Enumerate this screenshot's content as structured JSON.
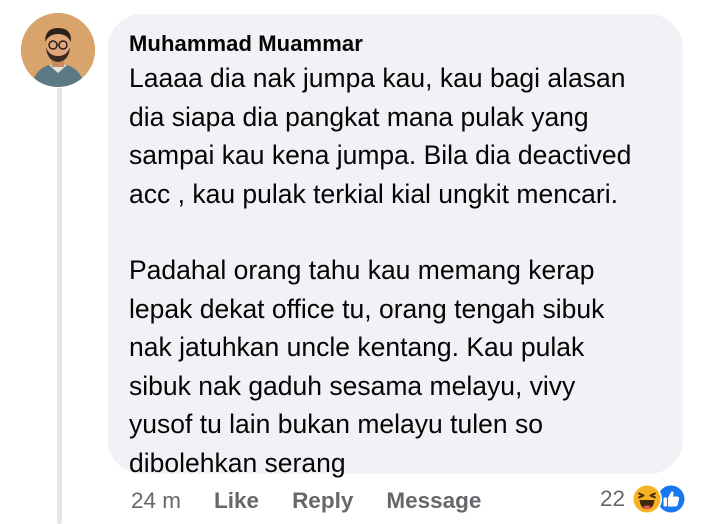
{
  "comment": {
    "author": "Muhammad Muammar",
    "paragraphs": [
      [
        "Laaaa dia nak jumpa kau, kau bagi alasan",
        "dia siapa dia pangkat mana pulak yang",
        "sampai kau kena jumpa. Bila dia deactived",
        "acc , kau pulak terkial kial ungkit mencari."
      ],
      [
        "Padahal orang tahu kau memang kerap",
        "lepak dekat office tu, orang tengah sibuk",
        "nak jatuhkan uncle kentang. Kau pulak",
        "sibuk nak gaduh sesama melayu, vivy",
        "yusof tu lain bukan melayu tulen so",
        "dibolehkan serang"
      ]
    ]
  },
  "actions": {
    "time": "24 m",
    "like_label": "Like",
    "reply_label": "Reply",
    "message_label": "Message"
  },
  "reactions": {
    "count": "22",
    "icons": [
      "haha-icon",
      "like-icon"
    ],
    "haha_color": "#f7b125",
    "like_color": "#1877f2"
  },
  "colors": {
    "bubble": "#f0f2f5",
    "secondary_text": "#65676b",
    "thread_line": "#e4e6e9"
  }
}
